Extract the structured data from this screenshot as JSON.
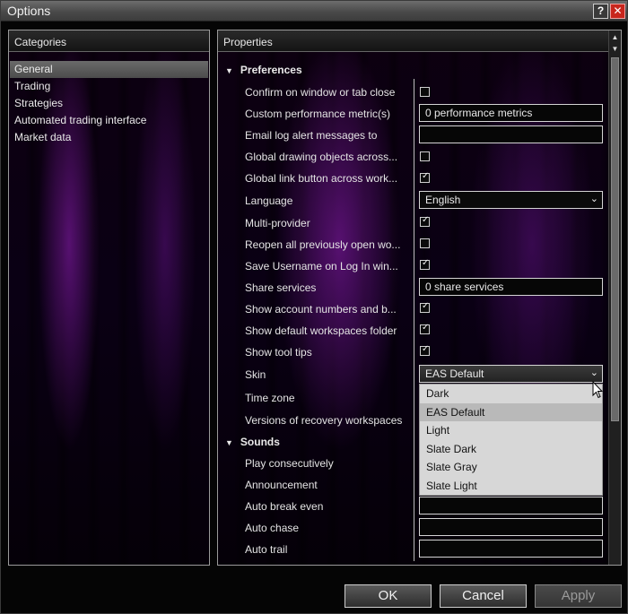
{
  "window": {
    "title": "Options",
    "help_label": "?",
    "close_label": "✕"
  },
  "categories": {
    "header": "Categories",
    "items": [
      {
        "label": "General",
        "selected": true
      },
      {
        "label": "Trading"
      },
      {
        "label": "Strategies"
      },
      {
        "label": "Automated trading interface"
      },
      {
        "label": "Market data"
      }
    ]
  },
  "properties": {
    "header": "Properties",
    "preferences": {
      "title": "Preferences",
      "rows": [
        {
          "label": "Confirm on window or tab close",
          "type": "checkbox",
          "checked": false
        },
        {
          "label": "Custom performance metric(s)",
          "type": "text",
          "value": "0 performance metrics"
        },
        {
          "label": "Email log alert messages to",
          "type": "text",
          "value": ""
        },
        {
          "label": "Global drawing objects across...",
          "type": "checkbox",
          "checked": false
        },
        {
          "label": "Global link button across work...",
          "type": "checkbox",
          "checked": true
        },
        {
          "label": "Language",
          "type": "dropdown",
          "value": "English"
        },
        {
          "label": "Multi-provider",
          "type": "checkbox",
          "checked": true
        },
        {
          "label": "Reopen all previously open wo...",
          "type": "checkbox",
          "checked": false
        },
        {
          "label": "Save Username on Log In win...",
          "type": "checkbox",
          "checked": true
        },
        {
          "label": "Share services",
          "type": "text",
          "value": "0 share services"
        },
        {
          "label": "Show account numbers and b...",
          "type": "checkbox",
          "checked": true
        },
        {
          "label": "Show default workspaces folder",
          "type": "checkbox",
          "checked": true
        },
        {
          "label": "Show tool tips",
          "type": "checkbox",
          "checked": true
        },
        {
          "label": "Skin",
          "type": "dropdown",
          "value": "EAS Default",
          "open": true
        },
        {
          "label": "Time zone",
          "type": "dropdown",
          "value": ""
        },
        {
          "label": "Versions of recovery workspaces",
          "type": "text",
          "value": ""
        }
      ]
    },
    "sounds": {
      "title": "Sounds",
      "rows": [
        {
          "label": "Play consecutively",
          "type": "text",
          "value": ""
        },
        {
          "label": "Announcement",
          "type": "text",
          "value": ""
        },
        {
          "label": "Auto break even",
          "type": "text",
          "value": ""
        },
        {
          "label": "Auto chase",
          "type": "text",
          "value": ""
        },
        {
          "label": "Auto trail",
          "type": "text",
          "value": ""
        }
      ]
    }
  },
  "skin_options": {
    "items": [
      "Dark",
      "EAS Default",
      "Light",
      "Slate Dark",
      "Slate Gray",
      "Slate Light"
    ],
    "highlighted": "EAS Default"
  },
  "buttons": {
    "ok": "OK",
    "cancel": "Cancel",
    "apply": "Apply"
  },
  "icons": {
    "checkmark": "✓",
    "chevron": "⌄",
    "triangle": "▼",
    "scroll_up": "▲",
    "scroll_down": "▼"
  }
}
